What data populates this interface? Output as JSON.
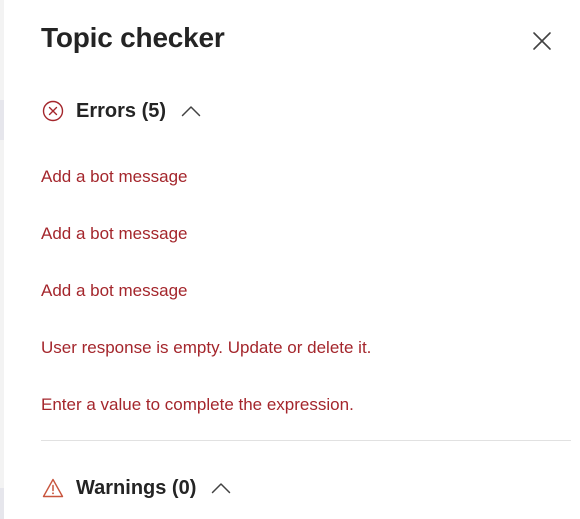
{
  "title": "Topic checker",
  "close_icon": "close-icon",
  "errors": {
    "label": "Errors (5)",
    "icon": "error-circle-icon",
    "color": "#a4262c",
    "items": [
      "Add a bot message",
      "Add a bot message",
      "Add a bot message",
      "User response is empty. Update or delete it.",
      "Enter a value to complete the expression."
    ]
  },
  "warnings": {
    "label": "Warnings (0)",
    "icon": "warning-triangle-icon",
    "color": "#c8553d"
  }
}
